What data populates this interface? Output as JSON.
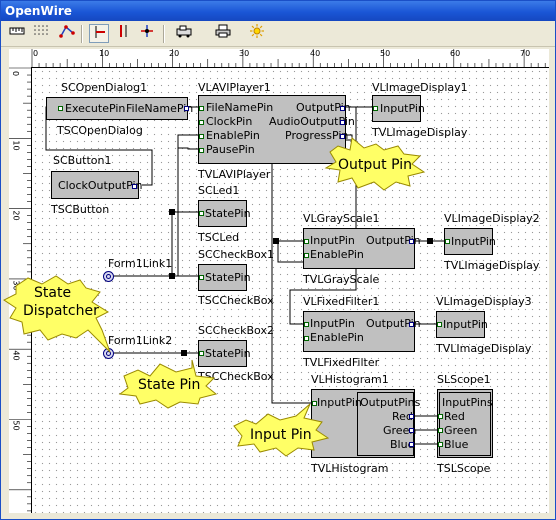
{
  "window": {
    "title": "OpenWire"
  },
  "toolbar": {
    "items": [
      "ruler-toggle",
      "grid-toggle",
      "layout-graph",
      "align-left",
      "align-right",
      "auto-route",
      "component-palette",
      "print",
      "highlight"
    ]
  },
  "ruler": {
    "top": [
      "0",
      "10",
      "20",
      "30",
      "40",
      "50",
      "60",
      "70"
    ],
    "left": [
      "0",
      "10",
      "20",
      "30",
      "40",
      "50"
    ]
  },
  "components": {
    "scopendialog": {
      "title": "SCOpenDialog1",
      "type": "TSCOpenDialog",
      "pins": {
        "execute": "ExecutePin",
        "filename": "FileNamePin"
      }
    },
    "scbutton": {
      "title": "SCButton1",
      "type": "TSCButton",
      "pins": {
        "clockout": "ClockOutputPin"
      }
    },
    "vlavi": {
      "title": "VLAVIPlayer1",
      "type": "TVLAVIPlayer",
      "pins": {
        "filename": "FileNamePin",
        "clock": "ClockPin",
        "enable": "EnablePin",
        "pause": "PausePin",
        "output": "OutputPin",
        "audio": "AudioOutputPin",
        "progress": "ProgressPin"
      }
    },
    "vldisp1": {
      "title": "VLImageDisplay1",
      "type": "TVLImageDisplay",
      "pins": {
        "input": "InputPin"
      }
    },
    "scled": {
      "title": "SCLed1",
      "type": "TSCLed",
      "pins": {
        "state": "StatePin"
      }
    },
    "sccheck1": {
      "title": "SCCheckBox1",
      "type": "TSCCheckBox",
      "pins": {
        "state": "StatePin"
      }
    },
    "sccheck2": {
      "title": "SCCheckBox2",
      "type": "TSCCheckBox",
      "pins": {
        "state": "StatePin"
      }
    },
    "vlgray": {
      "title": "VLGrayScale1",
      "type": "TVLGrayScale",
      "pins": {
        "input": "InputPin",
        "enable": "EnablePin",
        "output": "OutputPin"
      }
    },
    "vldisp2": {
      "title": "VLImageDisplay2",
      "type": "TVLImageDisplay",
      "pins": {
        "input": "InputPin"
      }
    },
    "vlfixed": {
      "title": "VLFixedFilter1",
      "type": "TVLFixedFilter",
      "pins": {
        "input": "InputPin",
        "enable": "EnablePin",
        "output": "OutputPin"
      }
    },
    "vldisp3": {
      "title": "VLImageDisplay3",
      "type": "TVLImageDisplay",
      "pins": {
        "input": "InputPin"
      }
    },
    "vlhist": {
      "title": "VLHistogram1",
      "type": "TVLHistogram",
      "pins": {
        "input": "InputPin",
        "outputs": "OutputPins",
        "red": "Red",
        "green": "Green",
        "blue": "Blue"
      }
    },
    "slscope": {
      "title": "SLScope1",
      "type": "TSLScope",
      "pins": {
        "inputs": "InputPins",
        "red": "Red",
        "green": "Green",
        "blue": "Blue"
      }
    },
    "form1link1": {
      "title": "Form1Link1"
    },
    "form1link2": {
      "title": "Form1Link2"
    }
  },
  "callouts": {
    "output_pin": "Output Pin",
    "state_dispatcher_1": "State",
    "state_dispatcher_2": "Dispatcher",
    "state_pin": "State Pin",
    "input_pin": "Input Pin"
  },
  "colors": {
    "titlebar": "#1a56d6",
    "callout": "#ffff66",
    "component": "#c0c0c0",
    "wire": "#000000"
  }
}
